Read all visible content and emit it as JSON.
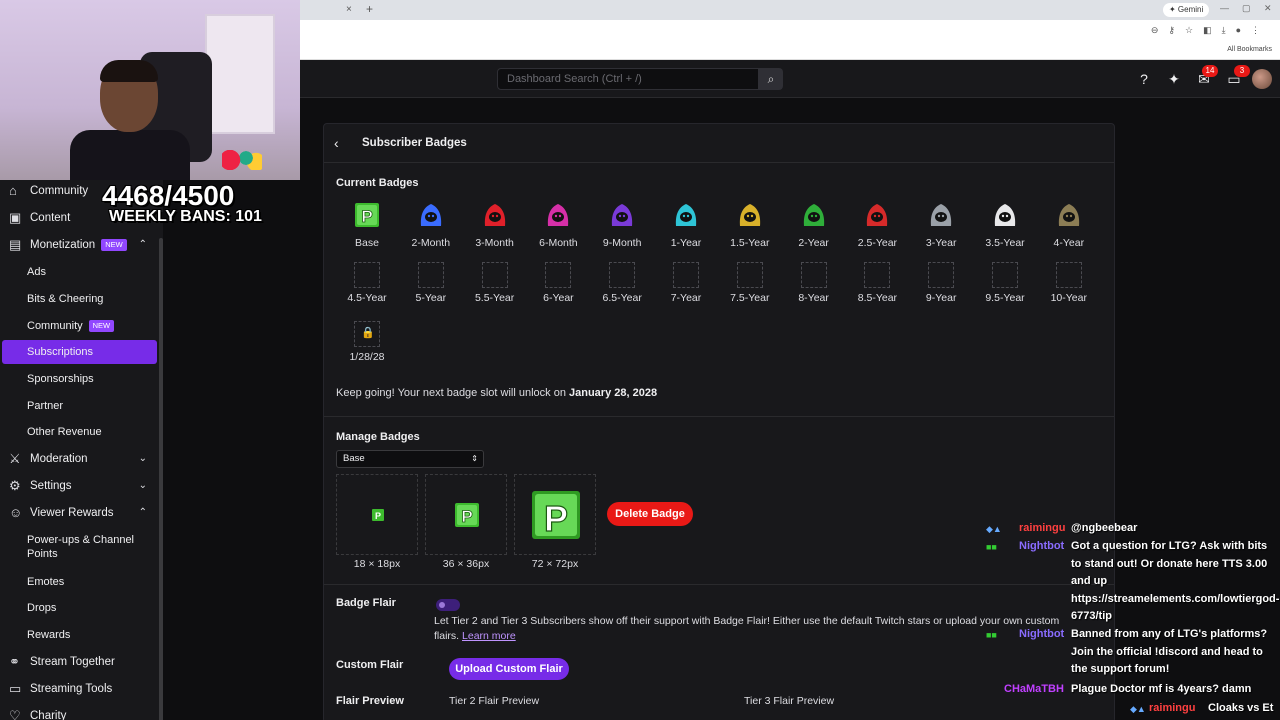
{
  "browser": {
    "tab_close": "×",
    "tab_new": "+",
    "gemini": "✦ Gemini",
    "all_bookmarks": "All Bookmarks"
  },
  "topbar": {
    "search_placeholder": "Dashboard Search (Ctrl + /)",
    "inbox_count": "14",
    "whispers_count": "3"
  },
  "overlay": {
    "ban_count": "4468/4500",
    "weekly_bans": "WEEKLY BANS: 101"
  },
  "sidebar": {
    "items": [
      {
        "label": "Community",
        "icon": "community-icon"
      },
      {
        "label": "Content",
        "icon": "content-icon"
      },
      {
        "label": "Monetization",
        "badge": "NEW",
        "icon": "monetization-icon"
      },
      {
        "label": "Moderation",
        "icon": "moderation-icon"
      },
      {
        "label": "Settings",
        "icon": "settings-icon"
      },
      {
        "label": "Viewer Rewards",
        "icon": "viewer-rewards-icon"
      },
      {
        "label": "Stream Together",
        "icon": "stream-together-icon"
      },
      {
        "label": "Streaming Tools",
        "icon": "streaming-tools-icon"
      },
      {
        "label": "Charity",
        "icon": "charity-icon"
      }
    ],
    "monetization_sub": [
      "Ads",
      "Bits & Cheering",
      "Community",
      "Subscriptions",
      "Sponsorships",
      "Partner",
      "Other Revenue"
    ],
    "community_sub_badge": "NEW",
    "rewards_sub": [
      "Power-ups & Channel Points",
      "Emotes",
      "Drops",
      "Rewards"
    ]
  },
  "card": {
    "title": "Subscriber Badges",
    "current_badges_label": "Current Badges",
    "badges_row1": [
      "Base",
      "2-Month",
      "3-Month",
      "6-Month",
      "9-Month",
      "1-Year",
      "1.5-Year",
      "2-Year",
      "2.5-Year",
      "3-Year",
      "3.5-Year",
      "4-Year"
    ],
    "badges_row2": [
      "4.5-Year",
      "5-Year",
      "5.5-Year",
      "6-Year",
      "6.5-Year",
      "7-Year",
      "7.5-Year",
      "8-Year",
      "8.5-Year",
      "9-Year",
      "9.5-Year",
      "10-Year"
    ],
    "locked_label": "1/28/28",
    "keep_going_prefix": "Keep going! Your next badge slot will unlock on ",
    "keep_going_date": "January 28, 2028",
    "manage_label": "Manage Badges",
    "select_value": "Base",
    "sizes": [
      "18 × 18px",
      "36 × 36px",
      "72 × 72px"
    ],
    "delete_label": "Delete Badge",
    "flair_label": "Badge Flair",
    "flair_text": "Let Tier 2 and Tier 3 Subscribers show off their support with Badge Flair! Either use the default Twitch stars or upload your own custom flairs.",
    "learn_more": "Learn more",
    "custom_flair_label": "Custom Flair",
    "upload_label": "Upload Custom Flair",
    "flair_preview_label": "Flair Preview",
    "tier2_preview": "Tier 2 Flair Preview",
    "tier3_preview": "Tier 3 Flair Preview",
    "colors": {
      "accent": "#772ce8",
      "danger": "#e91916",
      "badge_green": "#3dbb2e"
    }
  },
  "chat": {
    "messages": [
      {
        "user": "raimingu",
        "color": "#ff4040",
        "text": "@ngbeebear"
      },
      {
        "user": "Nightbot",
        "color": "#8a6cff",
        "text": "Got a question for LTG? Ask with bits to stand out! Or donate here TTS 3.00 and up https://streamelements.com/lowtiergod-6773/tip"
      },
      {
        "user": "Nightbot",
        "color": "#8a6cff",
        "text": "Banned from any of LTG's platforms? Join the official !discord and head to the support forum!"
      },
      {
        "user": "CHaMaTBH",
        "color": "#c040ff",
        "text": "Plague Doctor mf is 4years? damn"
      },
      {
        "user": "raimingu",
        "color": "#ff4040",
        "text": "Cloaks vs Et"
      }
    ]
  }
}
